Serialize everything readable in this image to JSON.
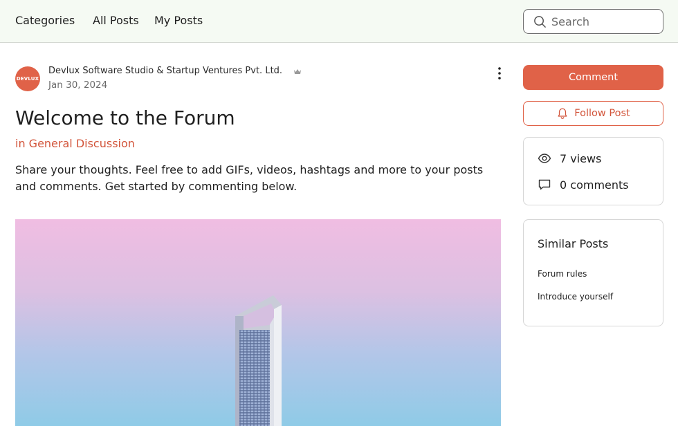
{
  "nav": {
    "items": [
      {
        "label": "Categories"
      },
      {
        "label": "All Posts"
      },
      {
        "label": "My Posts"
      }
    ],
    "search": {
      "placeholder": "Search",
      "value": ""
    }
  },
  "post": {
    "avatar_text": "DEVLUX",
    "author": "Devlux Software Studio & Startup Ventures Pvt. Ltd.",
    "date": "Jan 30, 2024",
    "title": "Welcome to the Forum",
    "category": "in General Discussion",
    "body": "Share your thoughts. Feel free to add GIFs, videos, hashtags and more to your posts and comments. Get started by commenting below."
  },
  "sidebar": {
    "comment_label": "Comment",
    "follow_label": "Follow Post",
    "stats": {
      "views": "7 views",
      "comments": "0 comments"
    },
    "similar": {
      "title": "Similar Posts",
      "links": [
        {
          "label": "Forum rules"
        },
        {
          "label": "Introduce yourself"
        }
      ]
    }
  },
  "colors": {
    "accent": "#e06248",
    "accent_text": "#d2543a",
    "topbar_bg": "#f5faf3"
  },
  "icons": [
    "search-icon",
    "crown-icon",
    "more-vertical-icon",
    "bell-icon",
    "eye-icon",
    "comment-bubble-icon"
  ]
}
